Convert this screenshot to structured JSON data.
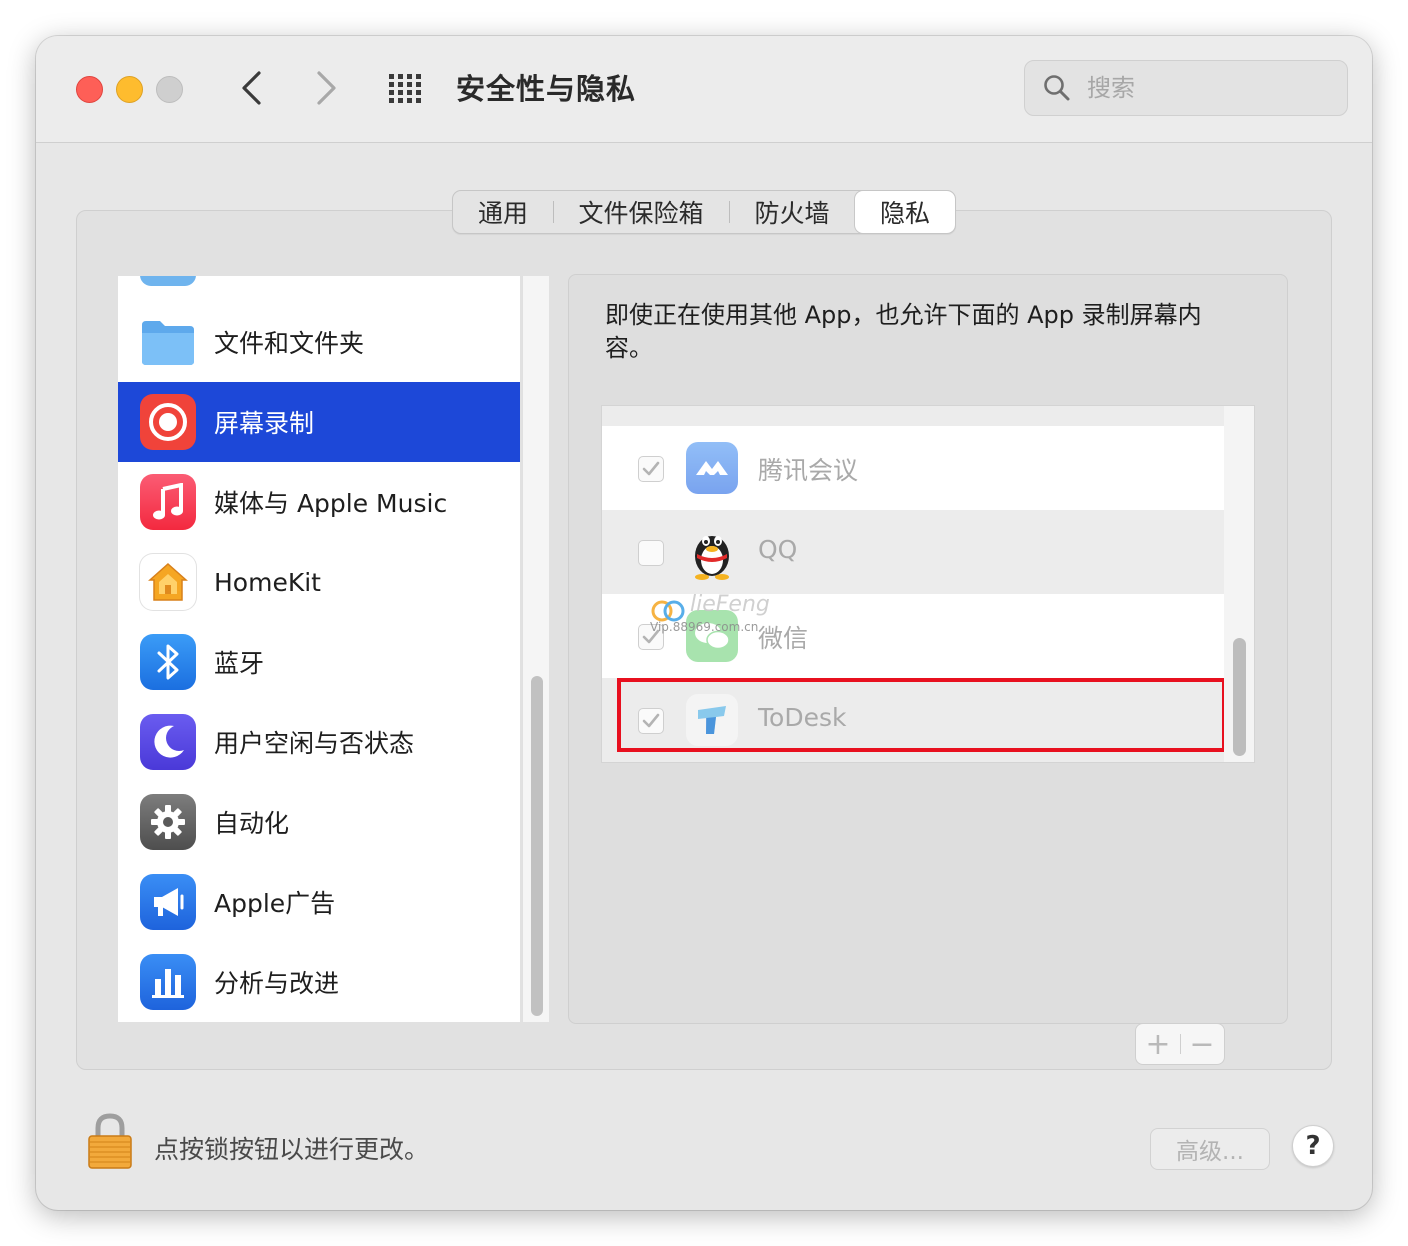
{
  "window": {
    "title": "安全性与隐私",
    "search_placeholder": "搜索"
  },
  "tabs": [
    {
      "label": "通用",
      "active": false
    },
    {
      "label": "文件保险箱",
      "active": false
    },
    {
      "label": "防火墙",
      "active": false
    },
    {
      "label": "隐私",
      "active": true
    }
  ],
  "sidebar": {
    "items": [
      {
        "label": "文件和文件夹",
        "icon": "folder-icon"
      },
      {
        "label": "屏幕录制",
        "icon": "screen-recording-icon",
        "selected": true
      },
      {
        "label": "媒体与 Apple Music",
        "icon": "music-icon"
      },
      {
        "label": "HomeKit",
        "icon": "home-icon"
      },
      {
        "label": "蓝牙",
        "icon": "bluetooth-icon"
      },
      {
        "label": "用户空闲与否状态",
        "icon": "moon-icon"
      },
      {
        "label": "自动化",
        "icon": "gear-icon"
      },
      {
        "label": "Apple广告",
        "icon": "megaphone-icon"
      },
      {
        "label": "分析与改进",
        "icon": "chart-icon"
      }
    ]
  },
  "panel": {
    "description": "即使正在使用其他 App，也允许下面的 App 录制屏幕内容。",
    "apps": [
      {
        "name": "腾讯会议",
        "checked": true,
        "icon": "tencent-meeting-icon"
      },
      {
        "name": "QQ",
        "checked": false,
        "icon": "qq-penguin-icon"
      },
      {
        "name": "微信",
        "checked": true,
        "icon": "wechat-icon"
      },
      {
        "name": "ToDesk",
        "checked": true,
        "icon": "todesk-icon",
        "highlighted": true
      }
    ],
    "add_label": "+",
    "remove_label": "−"
  },
  "watermark": {
    "line1": "lieFeng",
    "line2": "Vip.88969.com.cn"
  },
  "footer": {
    "lock_text": "点按锁按钮以进行更改。",
    "advanced_label": "高级...",
    "help_label": "?"
  },
  "colors": {
    "selection": "#1d48d8",
    "highlight_box": "#e8101f",
    "close": "#fe5f57",
    "minimize": "#febc2e"
  }
}
